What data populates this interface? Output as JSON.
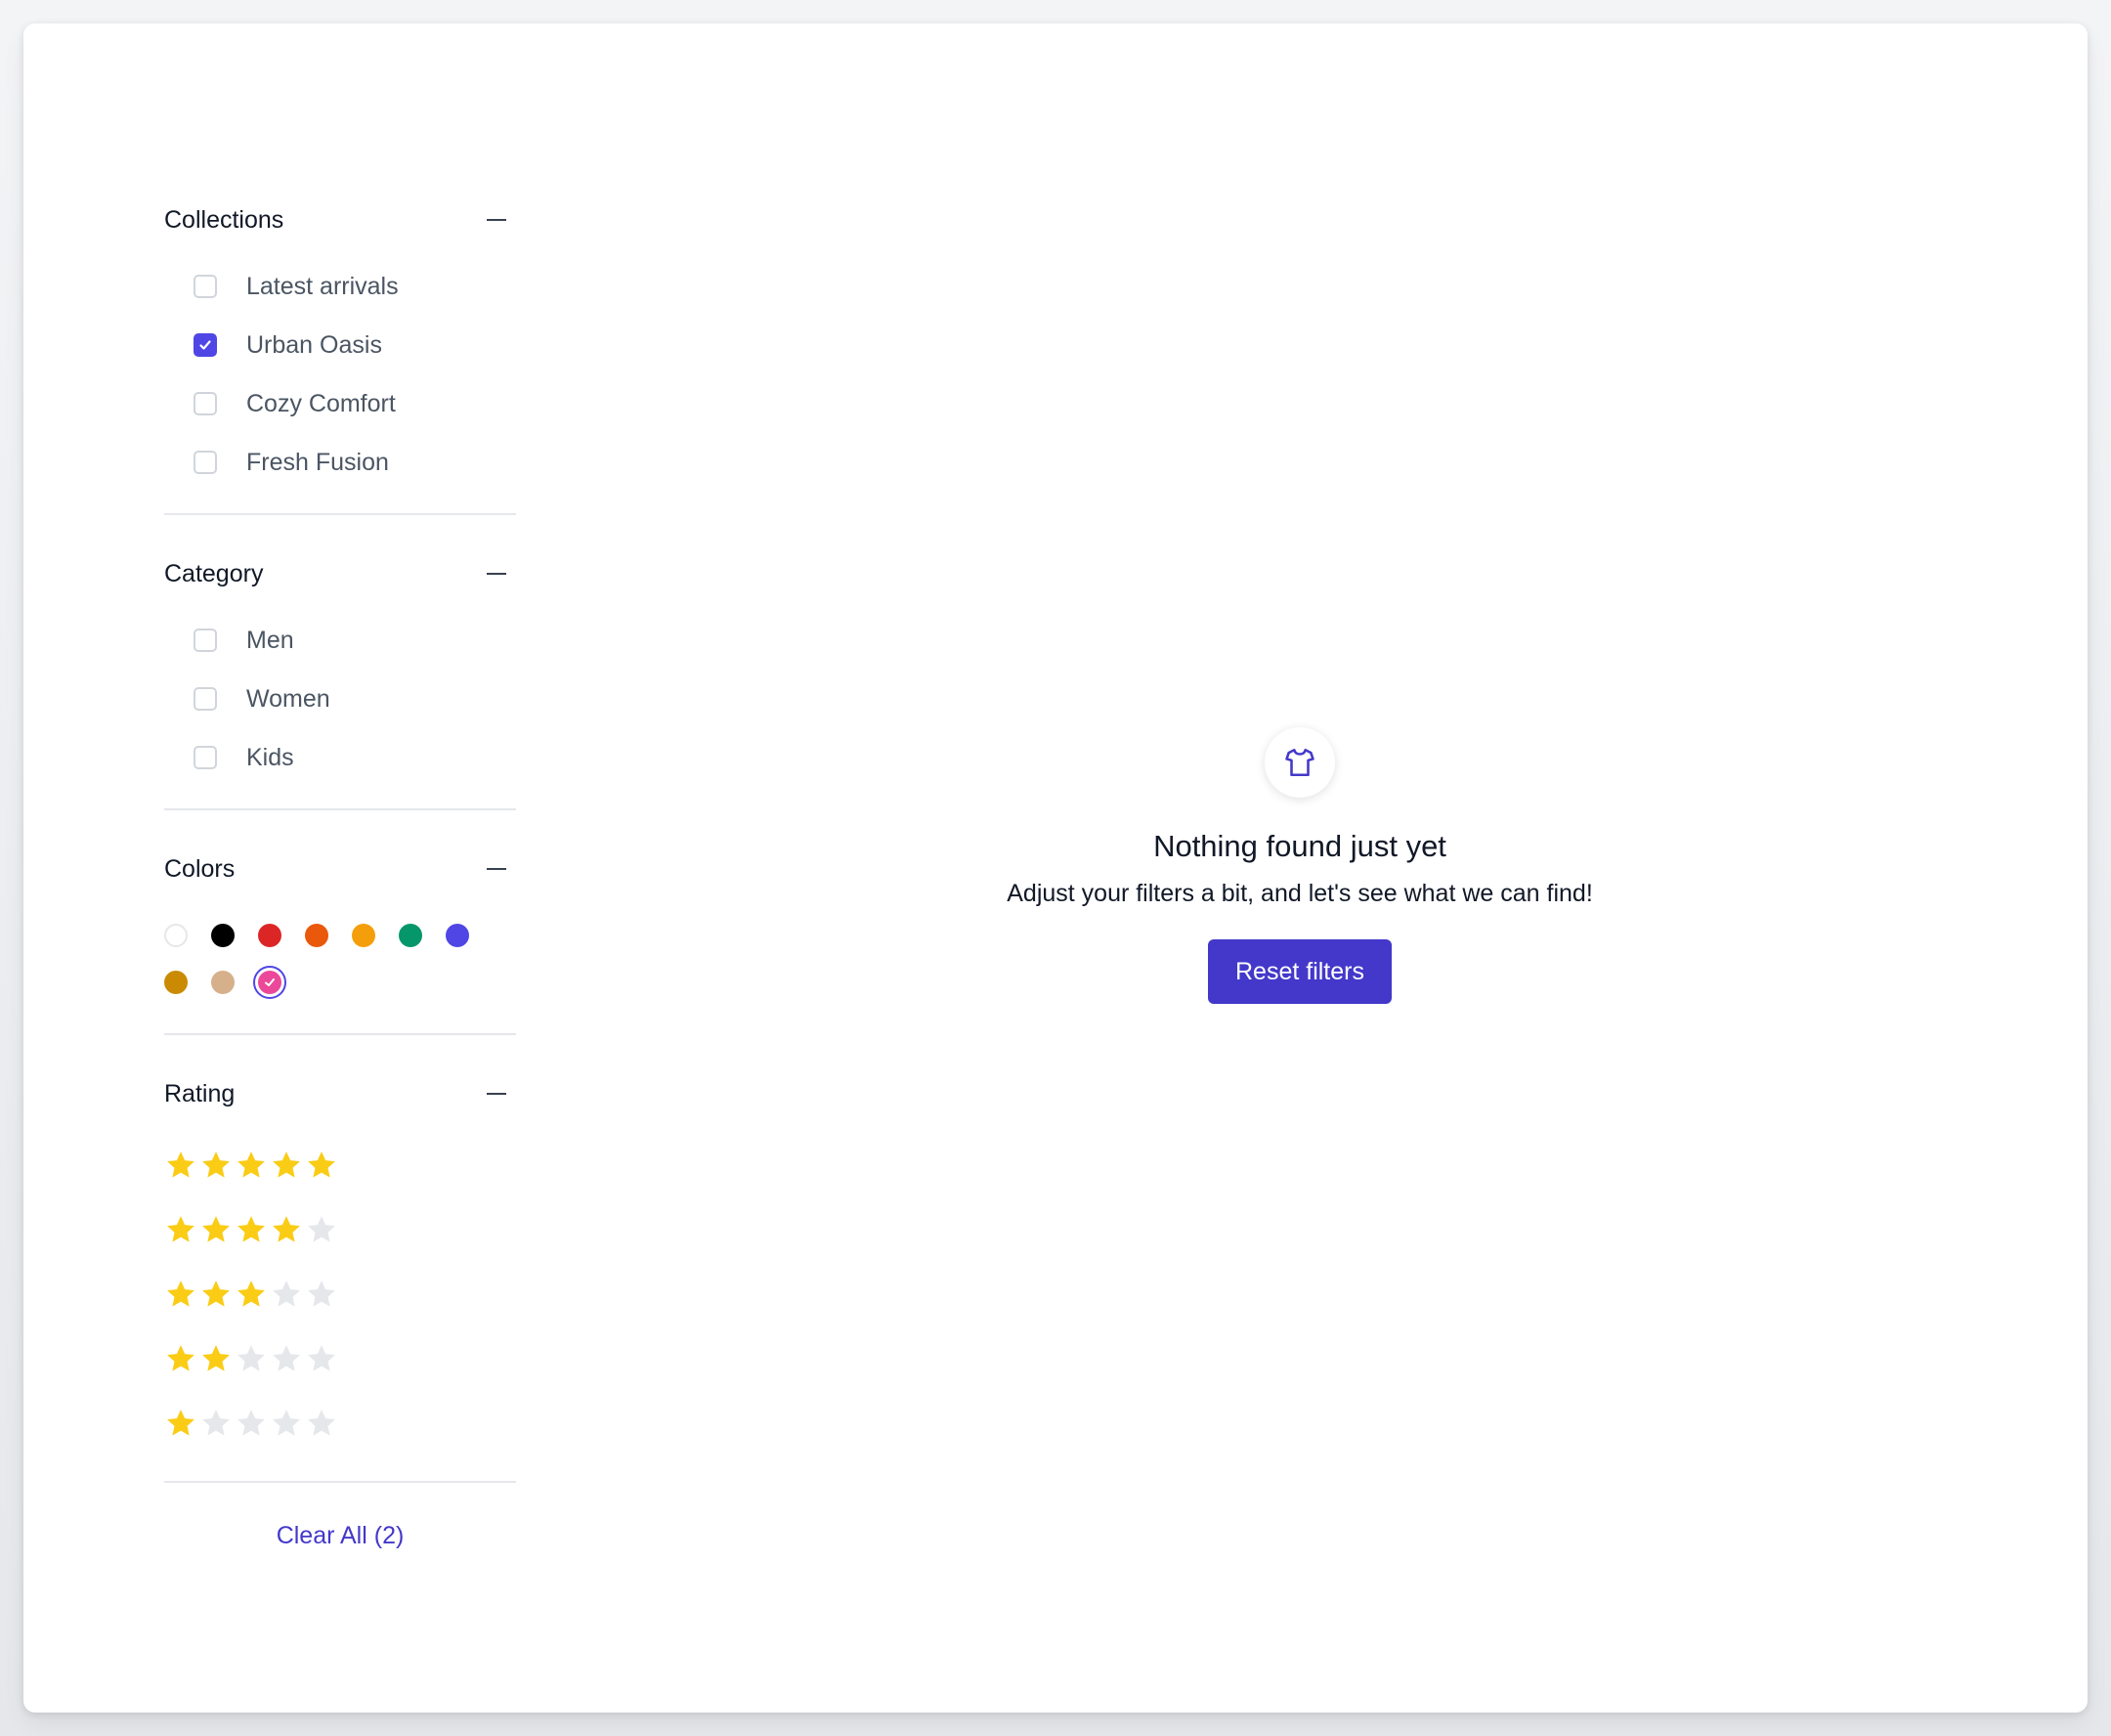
{
  "filters": {
    "collections": {
      "title": "Collections",
      "items": [
        {
          "label": "Latest arrivals",
          "checked": false
        },
        {
          "label": "Urban Oasis",
          "checked": true
        },
        {
          "label": "Cozy Comfort",
          "checked": false
        },
        {
          "label": "Fresh Fusion",
          "checked": false
        }
      ]
    },
    "category": {
      "title": "Category",
      "items": [
        {
          "label": "Men",
          "checked": false
        },
        {
          "label": "Women",
          "checked": false
        },
        {
          "label": "Kids",
          "checked": false
        }
      ]
    },
    "colors": {
      "title": "Colors",
      "swatches": [
        {
          "name": "white",
          "hex": "#ffffff",
          "selected": false
        },
        {
          "name": "black",
          "hex": "#000000",
          "selected": false
        },
        {
          "name": "red",
          "hex": "#dc2626",
          "selected": false
        },
        {
          "name": "orange",
          "hex": "#ea580c",
          "selected": false
        },
        {
          "name": "amber",
          "hex": "#f59e0b",
          "selected": false
        },
        {
          "name": "green",
          "hex": "#059669",
          "selected": false
        },
        {
          "name": "indigo",
          "hex": "#4f46e5",
          "selected": false
        },
        {
          "name": "gold",
          "hex": "#ca8a04",
          "selected": false
        },
        {
          "name": "tan",
          "hex": "#d6b08a",
          "selected": false
        },
        {
          "name": "pink",
          "hex": "#ec4899",
          "selected": true
        }
      ]
    },
    "rating": {
      "title": "Rating",
      "levels": [
        5,
        4,
        3,
        2,
        1
      ],
      "max": 5
    },
    "clear_all": "Clear All (2)"
  },
  "empty_state": {
    "icon": "shirt-icon",
    "title": "Nothing found just yet",
    "subtitle": "Adjust your filters a bit, and let's see what we can find!",
    "button": "Reset filters"
  },
  "colors": {
    "accent": "#4338ca",
    "star_filled": "#facc15",
    "star_empty": "#e5e7eb"
  }
}
